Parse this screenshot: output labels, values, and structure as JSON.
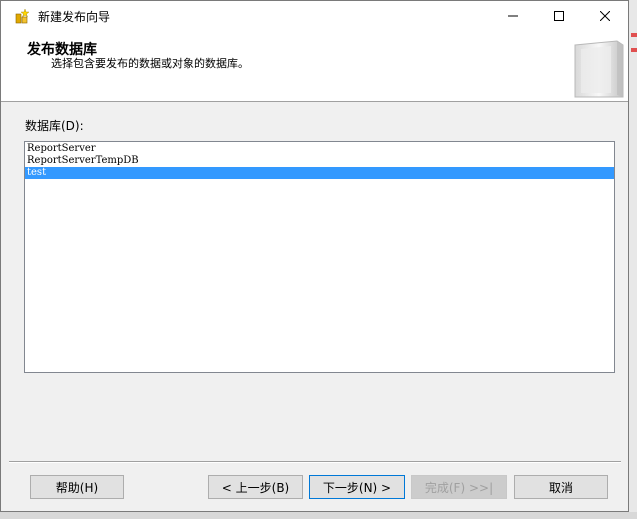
{
  "window": {
    "title": "新建发布向导"
  },
  "header": {
    "title": "发布数据库",
    "subtitle": "选择包含要发布的数据或对象的数据库。"
  },
  "database_list": {
    "label": "数据库(D):",
    "items": [
      {
        "name": "ReportServer",
        "selected": false
      },
      {
        "name": "ReportServerTempDB",
        "selected": false
      },
      {
        "name": "test",
        "selected": true
      }
    ]
  },
  "buttons": {
    "help": "帮助(H)",
    "prev": "< 上一步(B)",
    "next": "下一步(N) >",
    "finish": "完成(F) >>|",
    "cancel": "取消"
  },
  "colors": {
    "selection": "#3399ff",
    "focus_border": "#0078d7"
  }
}
